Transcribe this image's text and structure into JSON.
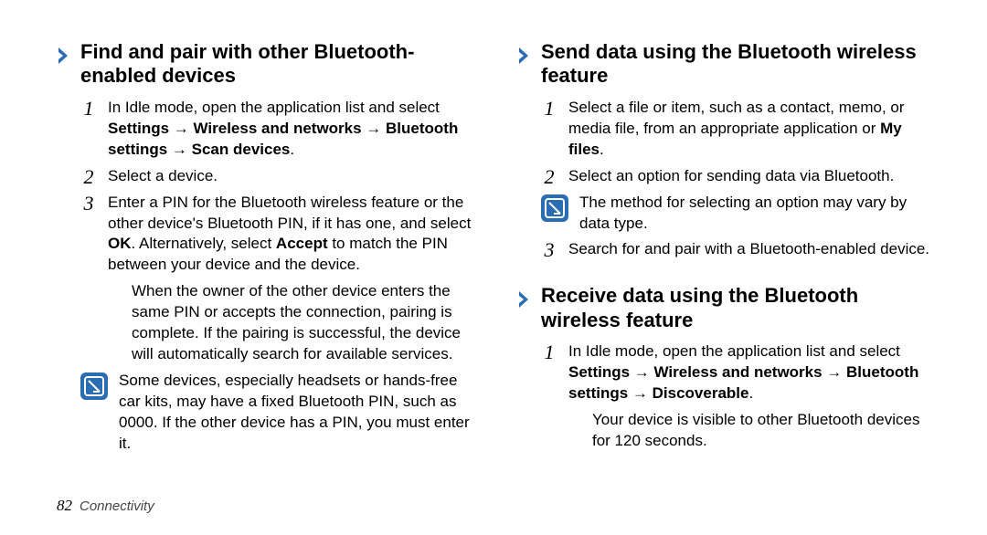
{
  "left": {
    "section1": {
      "title": "Find and pair with other Bluetooth-enabled devices",
      "step1_a": "In Idle mode, open the application list and select ",
      "step1_b": "Settings → Wireless and networks → Bluetooth settings → Scan devices",
      "step1_c": ".",
      "step2": "Select a device.",
      "step3_a": "Enter a PIN for the Bluetooth wireless feature or the other device's Bluetooth PIN, if it has one, and select ",
      "step3_b": "OK",
      "step3_c": ". Alternatively, select ",
      "step3_d": "Accept",
      "step3_e": " to match the PIN between your device and the device.",
      "step3_para2": "When the owner of the other device enters the same PIN or accepts the connection, pairing is complete. If the pairing is successful, the device will automatically search for available services.",
      "note": "Some devices, especially headsets or hands-free car kits, may have a fixed Bluetooth PIN, such as 0000. If the other device has a PIN, you must enter it."
    }
  },
  "right": {
    "section1": {
      "title": "Send data using the Bluetooth wireless feature",
      "step1_a": "Select a file or item, such as a contact, memo, or media file, from an appropriate application or ",
      "step1_b": "My files",
      "step1_c": ".",
      "step2": "Select an option for sending data via Bluetooth.",
      "note": "The method for selecting an option may vary by data type.",
      "step3": "Search for and pair with a Bluetooth-enabled device."
    },
    "section2": {
      "title": "Receive data using the Bluetooth wireless feature",
      "step1_a": "In Idle mode, open the application list and select ",
      "step1_b": "Settings → Wireless and networks → Bluetooth settings → Discoverable",
      "step1_c": ".",
      "step1_para2": "Your device is visible to other Bluetooth devices for 120 seconds."
    }
  },
  "footer": {
    "page": "82",
    "label": "Connectivity"
  },
  "nums": {
    "n1": "1",
    "n2": "2",
    "n3": "3"
  }
}
